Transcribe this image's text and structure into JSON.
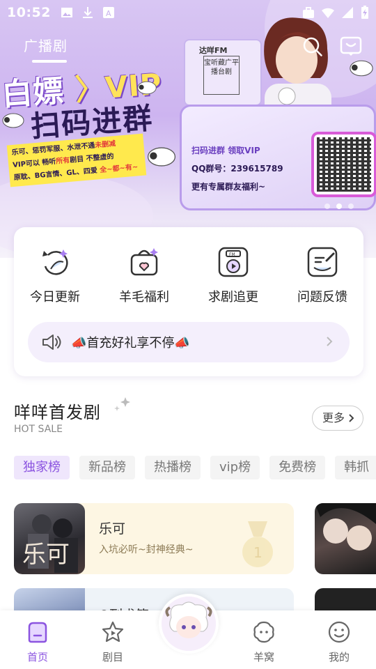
{
  "status_bar": {
    "time": "10:52"
  },
  "header": {
    "tab_label": "广播剧"
  },
  "banner": {
    "title_line1": "白嫖",
    "title_line1_vip": "VIP",
    "title_line2": "扫码进群",
    "note_line1": "乐可、惩罚军服、水泄不通",
    "note_line1_red": "未删减",
    "note_line2": "VIP可以 畅听",
    "note_line2_red": "所有",
    "note_line2_end": "剧目 不整虚的",
    "note_line3": "原耽、BG言情、GL、四爱",
    "note_line3_red": "全~都~有~",
    "fm_name": "达咩FM",
    "stamp_text": "宝听藏广平播台剧",
    "side_text": "达咩FM",
    "card_line1": "扫码进群 领取VIP",
    "card_line2": "QQ群号：239615789",
    "card_line3": "更有专属群友福利~",
    "dots_total": 3,
    "dots_active": 2
  },
  "quick_links": [
    {
      "label": "今日更新",
      "icon": "update-icon"
    },
    {
      "label": "羊毛福利",
      "icon": "gift-box-icon"
    },
    {
      "label": "求剧追更",
      "icon": "radio-fm-icon"
    },
    {
      "label": "问题反馈",
      "icon": "feedback-icon"
    }
  ],
  "notice": {
    "text": "📣首充好礼享不停📣"
  },
  "section": {
    "title": "咩咩首发剧",
    "subtitle": "HOT SALE",
    "more_label": "更多"
  },
  "chips": [
    "独家榜",
    "新品榜",
    "热播榜",
    "vip榜",
    "免费榜",
    "韩抓"
  ],
  "dramas": [
    {
      "name": "乐可",
      "desc": "入坑必听~封神经典~",
      "cover_text": "乐可"
    },
    {
      "name": "Q列求签",
      "desc": ""
    }
  ],
  "bottom_nav": [
    {
      "label": "首页",
      "icon": "home-icon",
      "active": true
    },
    {
      "label": "剧目",
      "icon": "star-icon",
      "active": false
    },
    {
      "label": "羊窝",
      "icon": "sheep-icon",
      "active": false
    },
    {
      "label": "我的",
      "icon": "smile-icon",
      "active": false
    }
  ],
  "colors": {
    "accent": "#8b54e0",
    "banner": "#cdb4f0"
  }
}
